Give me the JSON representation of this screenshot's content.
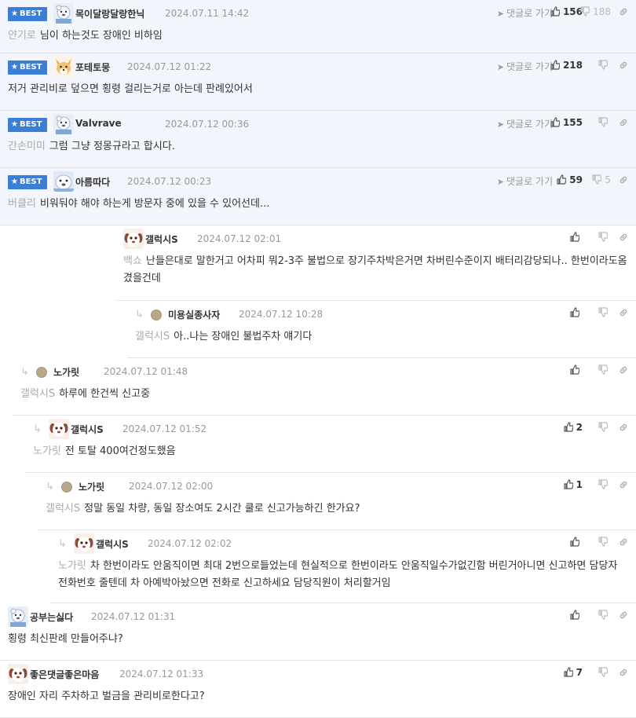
{
  "labels": {
    "best": "BEST",
    "go_reply": "댓글로 가기"
  },
  "comments": [
    {
      "nick": "목이달랑달랑한닉",
      "date": "2024.07.11 14:42",
      "target": "얀기로",
      "text": "님이 하는것도 장애인 비하임",
      "likes": "156",
      "dislikes": "188"
    },
    {
      "nick": "포테토뭉",
      "date": "2024.07.12 01:22",
      "target": "",
      "text": "저거 관리비로 덮으면 횡령 걸리는거로 아는데 판례있어서",
      "likes": "218",
      "dislikes": ""
    },
    {
      "nick": "Valvrave",
      "date": "2024.07.12 00:36",
      "target": "간손미미",
      "text": "그럼 그냥 정몽규라고 합시다.",
      "likes": "155",
      "dislikes": ""
    },
    {
      "nick": "아름따다",
      "date": "2024.07.12 00:23",
      "target": "버클리",
      "text": "비워둬야 해야 하는게 방문자 중에 있을 수 있어선데...",
      "likes": "59",
      "dislikes": "5"
    },
    {
      "nick": "갤럭시S",
      "date": "2024.07.12 02:01",
      "target": "백쇼",
      "text": "난들은대로 말한거고 어차피 뭐2-3주 불법으로 장기주차박은거면 차버린수준이지 배터리감당되나.. 한번이라도옴겼을건데",
      "likes": "",
      "dislikes": ""
    },
    {
      "nick": "미용실종사자",
      "date": "2024.07.12 10:28",
      "target": "갤럭시S",
      "text": "아..나는 장애인 불법주차 얘기다",
      "likes": "",
      "dislikes": ""
    },
    {
      "nick": "노가릿",
      "date": "2024.07.12 01:48",
      "target": "갤럭시S",
      "text": "하루에 한건씩 신고중",
      "likes": "",
      "dislikes": ""
    },
    {
      "nick": "갤럭시S",
      "date": "2024.07.12 01:52",
      "target": "노가릿",
      "text": "전 토탈 400여건정도했음",
      "likes": "2",
      "dislikes": ""
    },
    {
      "nick": "노가릿",
      "date": "2024.07.12 02:00",
      "target": "갤럭시S",
      "text": "정말 동일 차량, 동일 장소여도 2시간 쿨로 신고가능하긴 한가요?",
      "likes": "1",
      "dislikes": ""
    },
    {
      "nick": "갤럭시S",
      "date": "2024.07.12 02:02",
      "target": "노가릿",
      "text": "차 한번이라도 안움직이면 최대 2번으로들었는데 현실적으로 한번이라도 안움직일수가없긴함 버린거아니면 신고하면 담당자 전화번호 줄텐데 차 아예박아놨으면 전화로 신고하세요 담당직원이 처리할거임",
      "likes": "",
      "dislikes": ""
    },
    {
      "nick": "공부는싫다",
      "date": "2024.07.12 01:31",
      "target": "",
      "text": "횡령 최신판례 만들어주냐?",
      "likes": "",
      "dislikes": ""
    },
    {
      "nick": "좋은댓글좋은마음",
      "date": "2024.07.12 01:33",
      "target": "",
      "text": "장애인 자리 주차하고 벌금을 관리비로한다고?",
      "likes": "7",
      "dislikes": ""
    }
  ]
}
